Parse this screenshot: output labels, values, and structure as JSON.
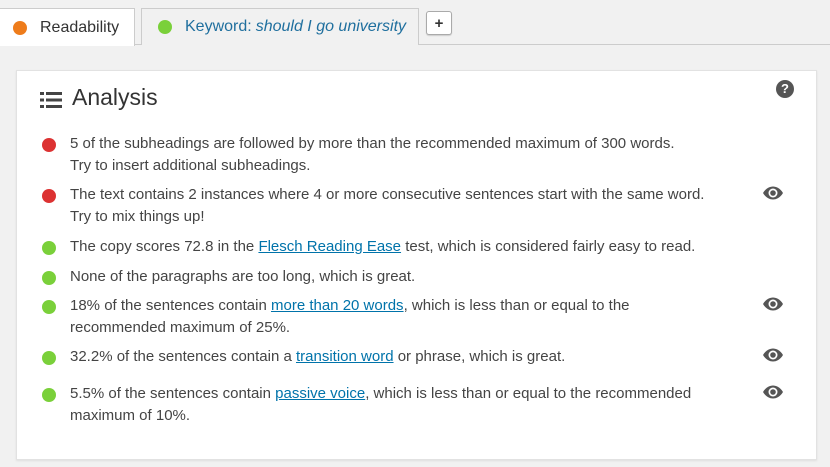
{
  "tabs": {
    "readability": {
      "label": "Readability",
      "status_color": "#ee7c1b"
    },
    "keyword": {
      "label": "Keyword:",
      "value": "should I go university",
      "status_color": "#7ad03a"
    },
    "add_label": "+"
  },
  "panel": {
    "title": "Analysis",
    "help_label": "?"
  },
  "results": [
    {
      "status_color": "#dc3232",
      "line1": "5 of the subheadings are followed by more than the recommended maximum of 300 words.",
      "line2": "Try to insert additional subheadings.",
      "has_eye": false
    },
    {
      "status_color": "#dc3232",
      "line1": "The text contains 2 instances where 4 or more consecutive sentences start with the same word.",
      "line2": "Try to mix things up!",
      "has_eye": true
    },
    {
      "status_color": "#7ad03a",
      "pre": "The copy scores 72.8 in the ",
      "link": "Flesch Reading Ease",
      "post": " test, which is considered fairly easy to read.",
      "has_eye": false
    },
    {
      "status_color": "#7ad03a",
      "line1": "None of the paragraphs are too long, which is great.",
      "has_eye": false
    },
    {
      "status_color": "#7ad03a",
      "pre": "18% of the sentences contain ",
      "link": "more than 20 words",
      "post": ", which is less than or equal to the",
      "line2": "recommended maximum of 25%.",
      "has_eye": true
    },
    {
      "status_color": "#7ad03a",
      "pre": "32.2% of the sentences contain a ",
      "link": "transition word",
      "post": " or phrase, which is great.",
      "has_eye": true
    },
    {
      "status_color": "#7ad03a",
      "pre": "5.5% of the sentences contain ",
      "link": "passive voice",
      "post": ", which is less than or equal to the recommended",
      "line2": "maximum of 10%.",
      "has_eye": true
    }
  ]
}
